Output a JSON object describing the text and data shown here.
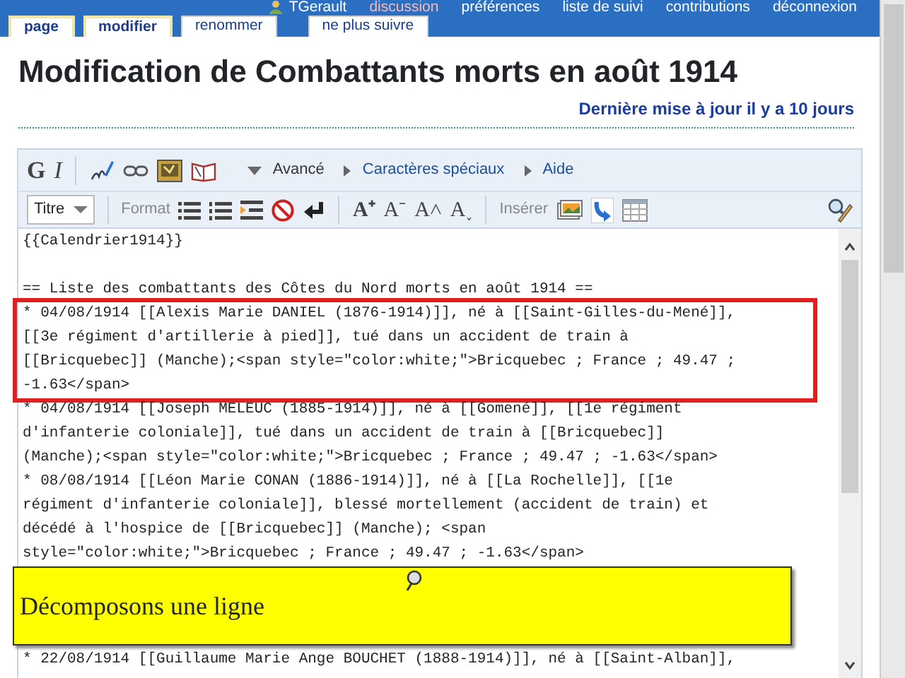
{
  "user_links": [
    {
      "label": "TGerault",
      "kind": "user"
    },
    {
      "label": "discussion",
      "kind": "missing"
    },
    {
      "label": "préférences",
      "kind": "link"
    },
    {
      "label": "liste de suivi",
      "kind": "link"
    },
    {
      "label": "contributions",
      "kind": "link"
    },
    {
      "label": "déconnexion",
      "kind": "link"
    }
  ],
  "tabs": [
    {
      "label": "page",
      "selected": true
    },
    {
      "label": "modifier",
      "selected": true
    },
    {
      "label": "renommer",
      "selected": false
    },
    {
      "label": "ne plus suivre",
      "selected": false
    }
  ],
  "title": "Modification de Combattants morts en août 1914",
  "last_update": "Dernière mise à jour il y a 10 jours",
  "toolbar": {
    "bold": "G",
    "italic": "I",
    "advanced": "Avancé",
    "special_chars": "Caractères spéciaux",
    "help": "Aide",
    "heading_select": "Titre",
    "format_label": "Format",
    "text_buttons": [
      "A⁺",
      "A⁻",
      "A˄",
      "A˯"
    ],
    "insert_label": "Insérer"
  },
  "editor_lines": [
    {
      "kind": "template",
      "lines": [
        "{{Calendrier1914}}"
      ],
      "highlighted": false
    },
    {
      "kind": "heading",
      "lines": [
        "== Liste des combattants des Côtes du Nord morts en août 1914 =="
      ],
      "highlighted": false
    },
    {
      "kind": "item",
      "lines": [
        "* 04/08/1914 [[Alexis Marie DANIEL (1876-1914)]], né à [[Saint-Gilles-du-Mené]],",
        "[[3e régiment d'artillerie à pied]], tué dans un accident de train à",
        "[[Bricquebec]] (Manche);<span style=\"color:white;\">Bricquebec ; France ; 49.47 ;",
        "-1.63</span>"
      ],
      "highlighted": true
    },
    {
      "kind": "item",
      "lines": [
        "* 04/08/1914 [[Joseph MELEUC (1885-1914)]], né à [[Gomené]], [[1e régiment",
        "d'infanterie coloniale]], tué dans un accident de train à [[Bricquebec]]",
        "(Manche);<span style=\"color:white;\">Bricquebec ; France ; 49.47 ; -1.63</span>"
      ],
      "highlighted": false
    },
    {
      "kind": "item",
      "lines": [
        "* 08/08/1914 [[Léon Marie CONAN (1886-1914)]], né à [[La Rochelle]], [[1e",
        "régiment d'infanterie coloniale]], blessé mortellement (accident de train) et",
        "décédé à l'hospice de [[Bricquebec]] (Manche); <span",
        "style=\"color:white;\">Bricquebec ; France ; 49.47 ; -1.63</span>"
      ],
      "highlighted": false
    },
    {
      "kind": "item",
      "lines": [
        "* 22/08/1914 [[Guillaume Marie Ange BOUCHET (1888-1914)]], né à [[Saint-Alban]],"
      ],
      "highlighted": false
    }
  ],
  "callout": {
    "text": "Décomposons une ligne"
  }
}
